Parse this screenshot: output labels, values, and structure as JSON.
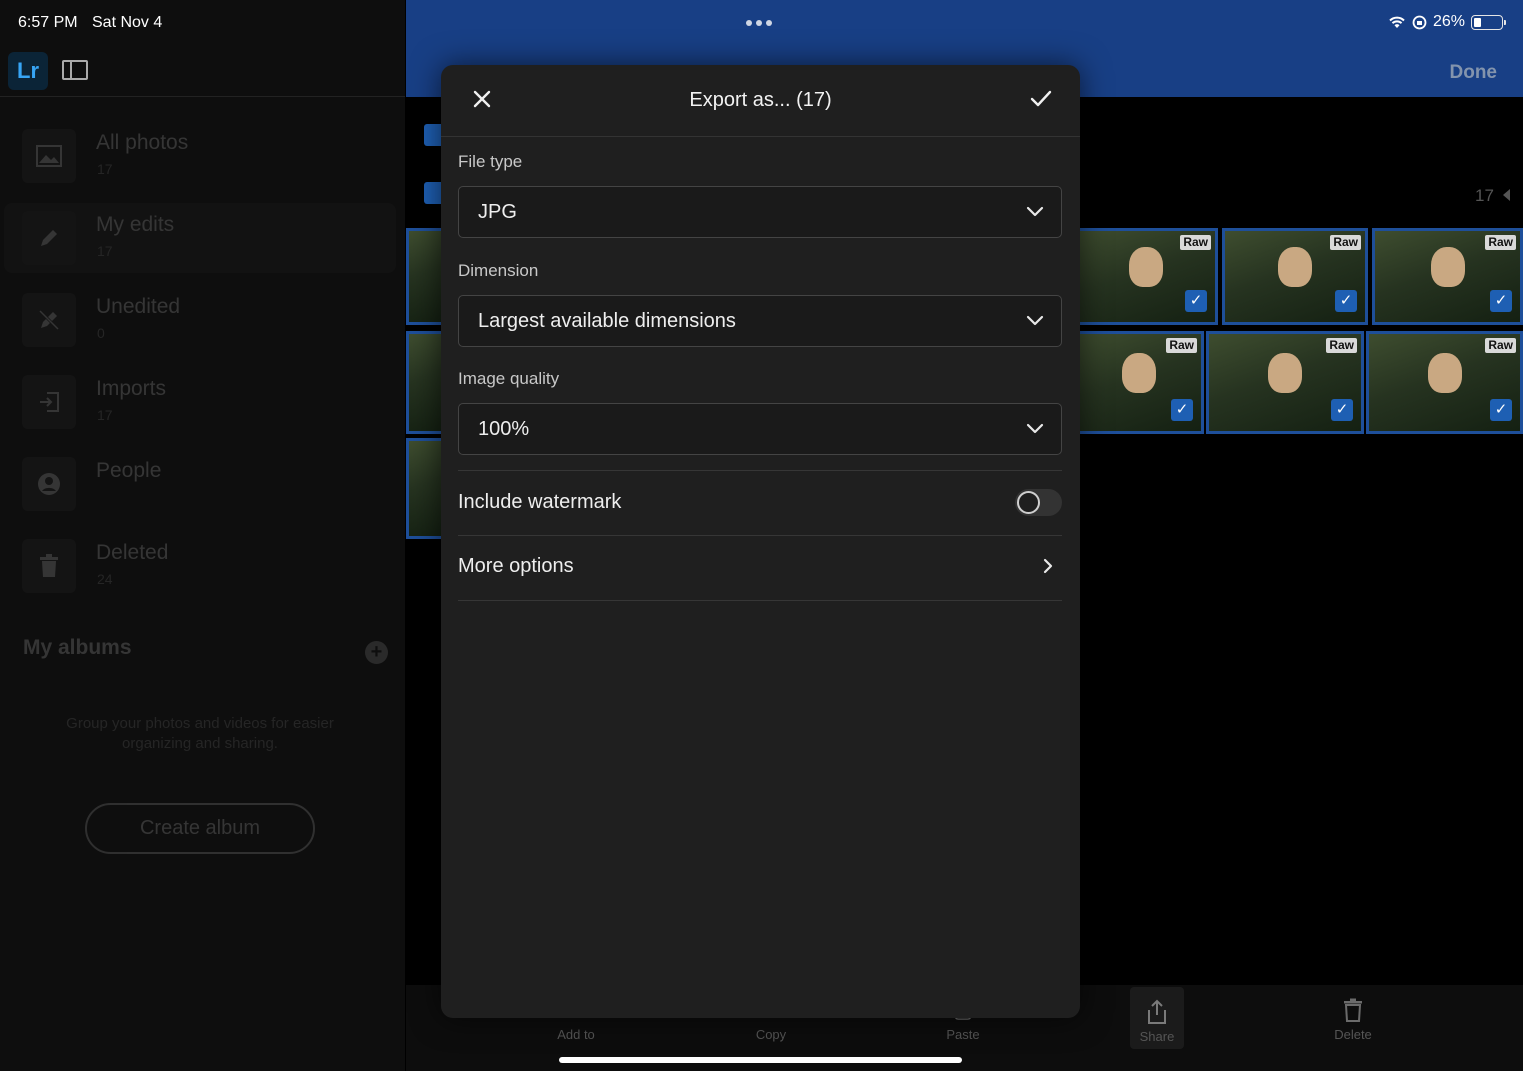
{
  "status_bar": {
    "time": "6:57 PM",
    "date": "Sat Nov 4",
    "battery": "26%"
  },
  "sidebar": {
    "logo": "Lr",
    "items": [
      {
        "label": "All photos",
        "count": "17",
        "icon": "image-icon"
      },
      {
        "label": "My edits",
        "count": "17",
        "icon": "pencil-icon"
      },
      {
        "label": "Unedited",
        "count": "0",
        "icon": "unedited-icon"
      },
      {
        "label": "Imports",
        "count": "17",
        "icon": "import-icon"
      },
      {
        "label": "People",
        "count": "",
        "icon": "person-icon"
      },
      {
        "label": "Deleted",
        "count": "24",
        "icon": "trash-icon"
      }
    ],
    "albums_title": "My albums",
    "albums_description": "Group your photos and videos for easier organizing and sharing.",
    "create_album": "Create album"
  },
  "header": {
    "done_label": "Done"
  },
  "grid": {
    "count": "17",
    "raw_badge": "Raw"
  },
  "toolbar": {
    "items": [
      {
        "label": "Add to",
        "icon": "add-to-icon"
      },
      {
        "label": "Copy",
        "icon": "copy-icon"
      },
      {
        "label": "Paste",
        "icon": "paste-icon"
      },
      {
        "label": "Share",
        "icon": "share-icon"
      },
      {
        "label": "Delete",
        "icon": "trash-icon"
      }
    ]
  },
  "dialog": {
    "title": "Export as... (17)",
    "file_type": {
      "label": "File type",
      "value": "JPG"
    },
    "dimension": {
      "label": "Dimension",
      "value": "Largest available dimensions"
    },
    "image_quality": {
      "label": "Image quality",
      "value": "100%"
    },
    "watermark": {
      "label": "Include watermark",
      "enabled": false
    },
    "more_options": "More options"
  },
  "colors": {
    "accent_blue": "#183f85",
    "selection_blue": "#1e5fb3",
    "dialog_bg": "#1f1f1f"
  }
}
